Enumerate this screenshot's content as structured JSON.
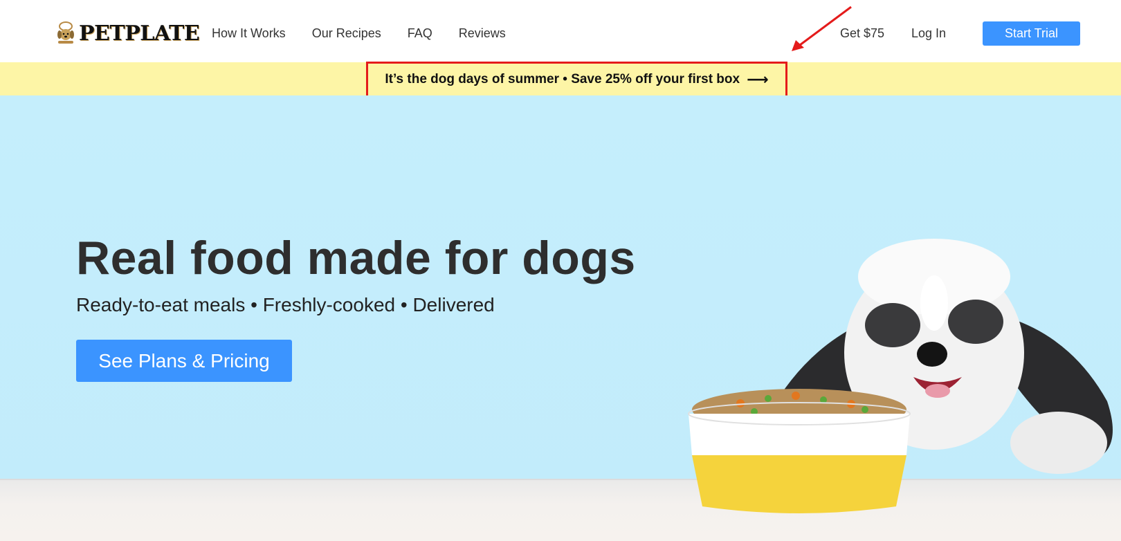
{
  "brand": {
    "name": "PetPlate",
    "logo_icon": "chef-dog-icon"
  },
  "nav": {
    "links": [
      "How It Works",
      "Our Recipes",
      "FAQ",
      "Reviews"
    ],
    "referral": "Get $75",
    "login": "Log In",
    "cta": "Start Trial"
  },
  "promo": {
    "text": "It’s the dog days of summer • Save 25% off your first box",
    "arrow": "⟶"
  },
  "hero": {
    "headline": "Real food made for dogs",
    "subheadline": "Ready-to-eat meals • Freshly-cooked • Delivered",
    "cta": "See Plans & Pricing"
  },
  "colors": {
    "accent": "#3b94ff",
    "promo_bg": "#fdf5a6",
    "hero_bg": "#c6eefb",
    "annotation": "#e41b1b",
    "bowl_yellow": "#f5d33c"
  }
}
